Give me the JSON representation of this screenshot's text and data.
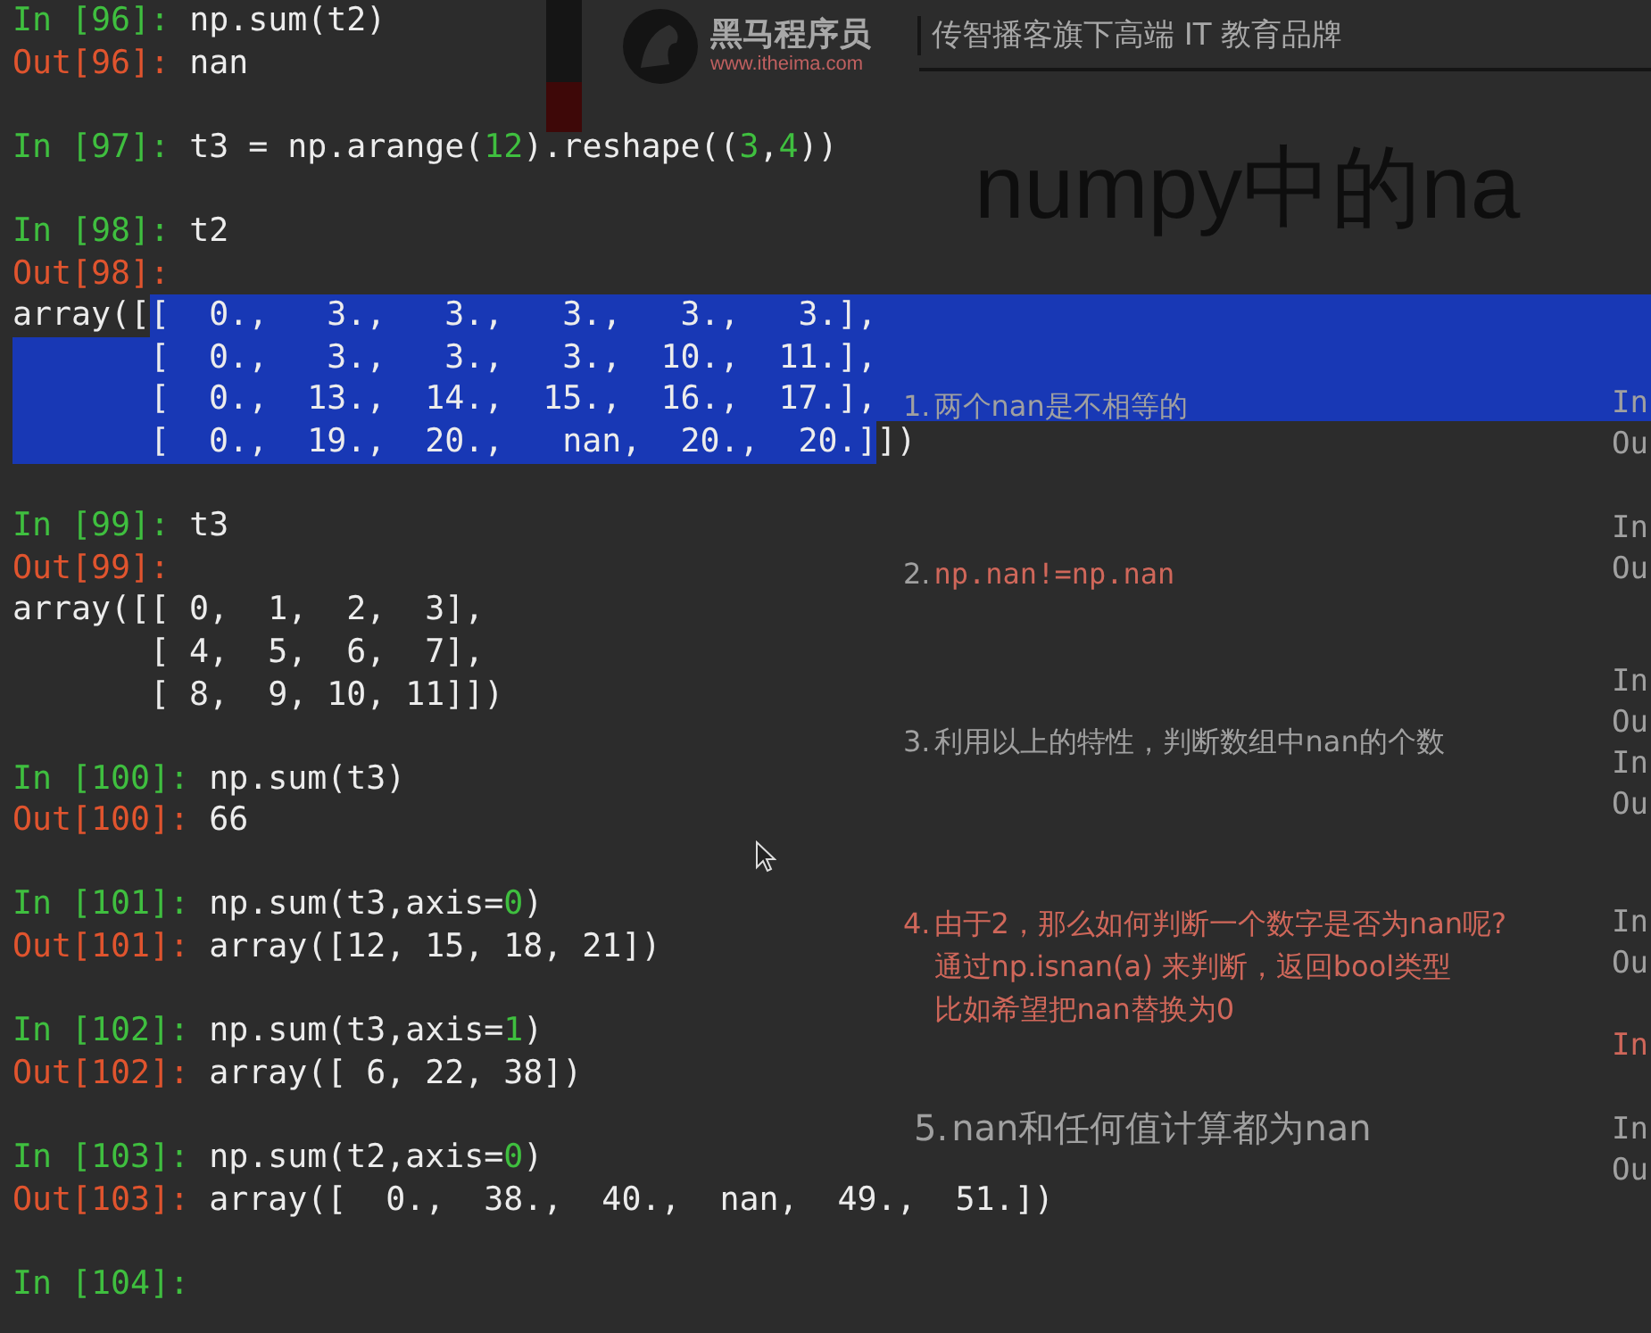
{
  "slide": {
    "logo_name": "黑马程序员",
    "logo_url": "www.itheima.com",
    "tagline": "传智播客旗下高端 IT 教育品牌",
    "title": "numpy中的na",
    "points": [
      {
        "number": "1.",
        "kind": "plain",
        "lines": [
          "两个nan是不相等的"
        ]
      },
      {
        "number": "2.",
        "kind": "code",
        "lines": [
          "np.nan!=np.nan"
        ]
      },
      {
        "number": "3.",
        "kind": "plain",
        "lines": [
          "利用以上的特性，判断数组中nan的个数"
        ]
      },
      {
        "number": "4.",
        "kind": "red",
        "lines": [
          "由于2，那么如何判断一个数字是否为nan呢?",
          "通过np.isnan(a) 来判断，返回bool类型",
          "比如希望把nan替换为0"
        ]
      },
      {
        "number": "5.",
        "kind": "large",
        "lines": [
          "nan和任何值计算都为nan"
        ]
      }
    ],
    "side_prompts": [
      {
        "text": "In",
        "kind": "plain"
      },
      {
        "text": "Ou",
        "kind": "plain"
      },
      {
        "text": "In",
        "kind": "plain"
      },
      {
        "text": "Ou",
        "kind": "plain"
      },
      {
        "text": "In",
        "kind": "plain"
      },
      {
        "text": "Ou",
        "kind": "plain"
      },
      {
        "text": "In",
        "kind": "plain"
      },
      {
        "text": "Ou",
        "kind": "plain"
      },
      {
        "text": "In",
        "kind": "plain"
      },
      {
        "text": "Ou",
        "kind": "plain"
      },
      {
        "text": "In",
        "kind": "red"
      },
      {
        "text": "In",
        "kind": "plain"
      },
      {
        "text": "Ou",
        "kind": "plain"
      }
    ]
  },
  "terminal": {
    "cells": [
      {
        "lines": [
          [
            {
              "text": "In [96]: ",
              "kind": "in"
            },
            {
              "text": "np.sum(t2)",
              "kind": "code"
            }
          ],
          [
            {
              "text": "Out[96]: ",
              "kind": "out"
            },
            {
              "text": "nan",
              "kind": "code"
            }
          ]
        ]
      },
      {
        "lines": [
          [
            {
              "text": "In [97]: ",
              "kind": "in"
            },
            {
              "text": "t3 = np.arange(",
              "kind": "code"
            },
            {
              "text": "12",
              "kind": "number"
            },
            {
              "text": ").reshape((",
              "kind": "code"
            },
            {
              "text": "3",
              "kind": "number"
            },
            {
              "text": ",",
              "kind": "code"
            },
            {
              "text": "4",
              "kind": "number"
            },
            {
              "text": "))",
              "kind": "code"
            }
          ]
        ]
      },
      {
        "lines": [
          [
            {
              "text": "In [98]: ",
              "kind": "in"
            },
            {
              "text": "t2",
              "kind": "code"
            }
          ],
          [
            {
              "text": "Out[98]:",
              "kind": "out"
            }
          ],
          [
            {
              "text": "array([",
              "kind": "code"
            },
            {
              "text": "[  0.,   3.,   3.,   3.,   3.,   3.],",
              "kind": "code",
              "selected": true
            }
          ],
          [
            {
              "text": "       [  0.,   3.,   3.,   3.,  10.,  11.],",
              "kind": "code",
              "selected": true
            }
          ],
          [
            {
              "text": "       [  0.,  13.,  14.,  15.,  16.,  17.],",
              "kind": "code",
              "selected": true
            }
          ],
          [
            {
              "text": "       [  0.,  19.,  20.,   nan,  20.,  20.]",
              "kind": "code",
              "selected": true
            },
            {
              "text": "])",
              "kind": "code",
              "selected": false
            }
          ]
        ]
      },
      {
        "lines": [
          [
            {
              "text": "In [99]: ",
              "kind": "in"
            },
            {
              "text": "t3",
              "kind": "code"
            }
          ],
          [
            {
              "text": "Out[99]:",
              "kind": "out"
            }
          ],
          [
            {
              "text": "array([[ 0,  1,  2,  3],",
              "kind": "code"
            }
          ],
          [
            {
              "text": "       [ 4,  5,  6,  7],",
              "kind": "code"
            }
          ],
          [
            {
              "text": "       [ 8,  9, 10, 11]])",
              "kind": "code"
            }
          ]
        ]
      },
      {
        "lines": [
          [
            {
              "text": "In [100]: ",
              "kind": "in"
            },
            {
              "text": "np.sum(t3)",
              "kind": "code"
            }
          ],
          [
            {
              "text": "Out[100]: ",
              "kind": "out"
            },
            {
              "text": "66",
              "kind": "code"
            }
          ]
        ]
      },
      {
        "lines": [
          [
            {
              "text": "In [101]: ",
              "kind": "in"
            },
            {
              "text": "np.sum(t3,axis=",
              "kind": "code"
            },
            {
              "text": "0",
              "kind": "number"
            },
            {
              "text": ")",
              "kind": "code"
            }
          ],
          [
            {
              "text": "Out[101]: ",
              "kind": "out"
            },
            {
              "text": "array([12, 15, 18, 21])",
              "kind": "code"
            }
          ]
        ]
      },
      {
        "lines": [
          [
            {
              "text": "In [102]: ",
              "kind": "in"
            },
            {
              "text": "np.sum(t3,axis=",
              "kind": "code"
            },
            {
              "text": "1",
              "kind": "number"
            },
            {
              "text": ")",
              "kind": "code"
            }
          ],
          [
            {
              "text": "Out[102]: ",
              "kind": "out"
            },
            {
              "text": "array([ 6, 22, 38])",
              "kind": "code"
            }
          ]
        ]
      },
      {
        "lines": [
          [
            {
              "text": "In [103]: ",
              "kind": "in"
            },
            {
              "text": "np.sum(t2,axis=",
              "kind": "code"
            },
            {
              "text": "0",
              "kind": "number"
            },
            {
              "text": ")",
              "kind": "code"
            }
          ],
          [
            {
              "text": "Out[103]: ",
              "kind": "out"
            },
            {
              "text": "array([  0.,  38.,  40.,  nan,  49.,  51.])",
              "kind": "code"
            }
          ]
        ]
      },
      {
        "lines": [
          [
            {
              "text": "In [104]:",
              "kind": "in"
            }
          ]
        ]
      }
    ]
  }
}
